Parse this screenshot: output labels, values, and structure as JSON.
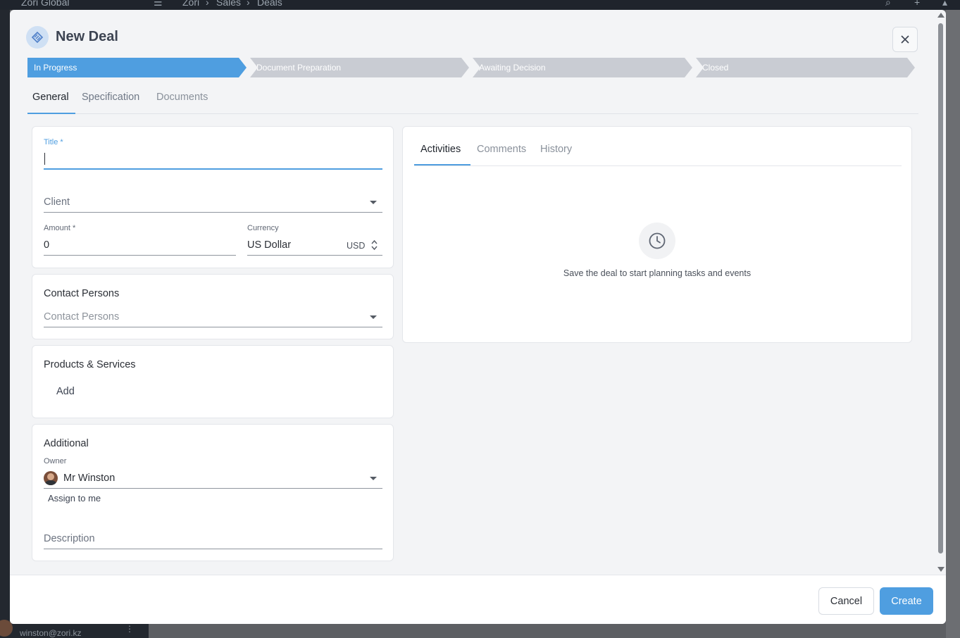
{
  "background_app": {
    "brand": "Zori Global",
    "breadcrumb": [
      "Zori",
      "Sales",
      "Deals"
    ],
    "user_email": "winston@zori.kz"
  },
  "modal": {
    "title": "New Deal",
    "stages": [
      {
        "label": "In Progress",
        "active": true
      },
      {
        "label": "Document Preparation",
        "active": false
      },
      {
        "label": "Awaiting Decision",
        "active": false
      },
      {
        "label": "Closed",
        "active": false
      }
    ],
    "tabs": [
      "General",
      "Specification",
      "Documents"
    ],
    "active_tab": "General"
  },
  "general": {
    "title_label": "Title *",
    "title_value": "",
    "client_placeholder": "Client",
    "amount_label": "Amount *",
    "amount_value": "0",
    "currency_label": "Currency",
    "currency_value": "US Dollar",
    "currency_code": "USD"
  },
  "contacts": {
    "heading": "Contact Persons",
    "placeholder": "Contact Persons"
  },
  "products": {
    "heading": "Products & Services",
    "add_label": "Add"
  },
  "additional": {
    "heading": "Additional",
    "owner_label": "Owner",
    "owner_value": "Mr Winston",
    "assign_label": "Assign to me",
    "description_placeholder": "Description"
  },
  "activity": {
    "tabs": [
      "Activities",
      "Comments",
      "History"
    ],
    "active_tab": "Activities",
    "empty_message": "Save the deal to start planning tasks and events"
  },
  "footer": {
    "cancel_label": "Cancel",
    "create_label": "Create"
  },
  "colors": {
    "accent": "#4f9ee0",
    "stage_inactive": "#c9ccd3",
    "surface": "#f3f4f6"
  }
}
